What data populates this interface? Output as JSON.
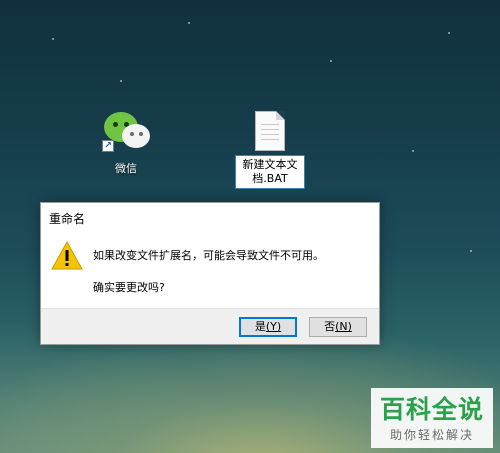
{
  "desktop": {
    "icons": [
      {
        "label": "微信",
        "icon": "wechat-icon"
      },
      {
        "label": "新建文本文档.BAT",
        "label_line1": "新建文本文",
        "label_line2": "档.BAT",
        "icon": "text-file-icon"
      }
    ]
  },
  "dialog": {
    "title": "重命名",
    "icon": "warning-icon",
    "message": "如果改变文件扩展名，可能会导致文件不可用。",
    "question": "确实要更改吗?",
    "buttons": {
      "yes_label": "是",
      "yes_hotkey": "(Y)",
      "no_label": "否",
      "no_hotkey": "(N)"
    }
  },
  "watermark": {
    "logo_text": "百科全说",
    "tagline": "助你轻松解决"
  },
  "colors": {
    "accent": "#0078d7",
    "wechat_green": "#6fc443",
    "warning_yellow": "#f5c400",
    "watermark_green": "#2aa24b"
  }
}
